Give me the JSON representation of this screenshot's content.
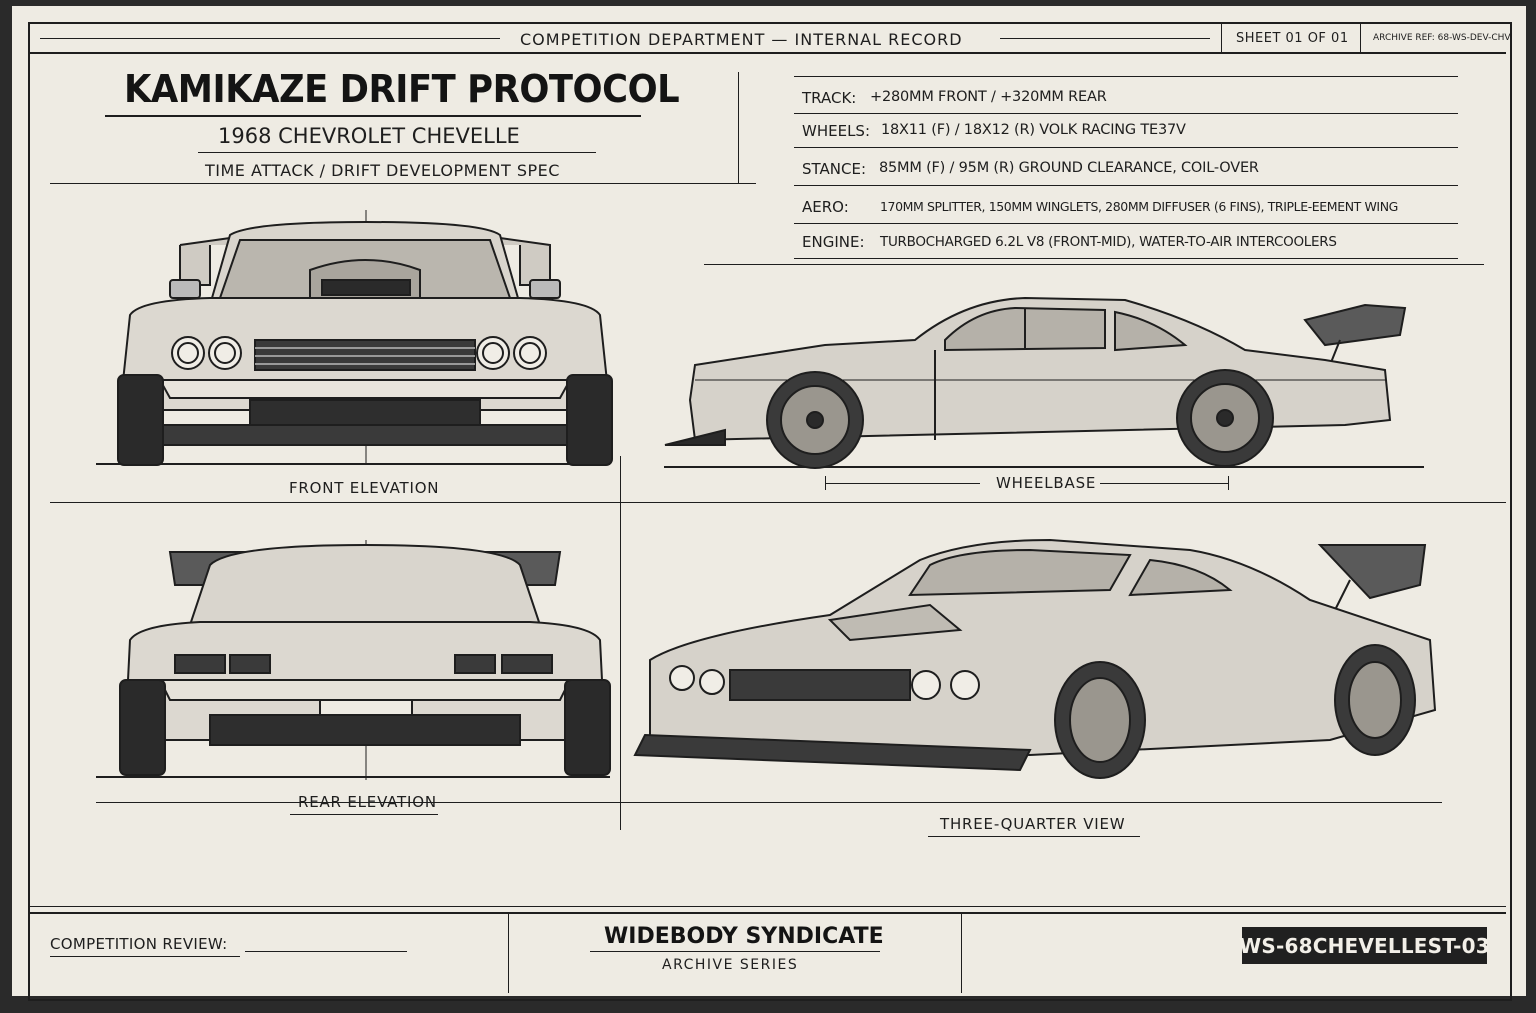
{
  "header": {
    "department": "COMPETITION DEPARTMENT — INTERNAL RECORD",
    "sheet": "SHEET 01 OF 01",
    "archive_ref": "ARCHIVE REF: 68-WS-DEV-CHV"
  },
  "title": {
    "main": "KAMIKAZE DRIFT PROTOCOL",
    "model": "1968 CHEVROLET CHEVELLE",
    "spec": "TIME ATTACK / DRIFT DEVELOPMENT SPEC"
  },
  "specs": [
    {
      "key": "TRACK:",
      "value": "+280MM FRONT / +320MM REAR"
    },
    {
      "key": "WHEELS:",
      "value": "18X11 (F) / 18X12 (R) VOLK RACING TE37V"
    },
    {
      "key": "STANCE:",
      "value": "85MM (F) / 95M (R) GROUND CLEARANCE, COIL-OVER"
    },
    {
      "key": "AERO:",
      "value": "170MM SPLITTER, 150MM WINGLETS, 280MM DIFFUSER (6 FINS), TRIPLE-EEMENT WING"
    },
    {
      "key": "ENGINE:",
      "value": "TURBOCHARGED 6.2L V8 (FRONT-MID), WATER-TO-AIR INTERCOOLERS"
    }
  ],
  "views": {
    "front": "FRONT ELEVATION",
    "wheelbase": "WHEELBASE",
    "rear": "REAR ELEVATION",
    "three_quarter": "THREE-QUARTER VIEW"
  },
  "footer": {
    "review_label": "COMPETITION REVIEW:",
    "brand": "WIDEBODY SYNDICATE",
    "series": "ARCHIVE SERIES",
    "code": "WS-68CHEVELLEST-03"
  },
  "colors": {
    "paper": "#eeebe3",
    "ink": "#1e1e1e",
    "backdrop": "#2a2a2a"
  }
}
